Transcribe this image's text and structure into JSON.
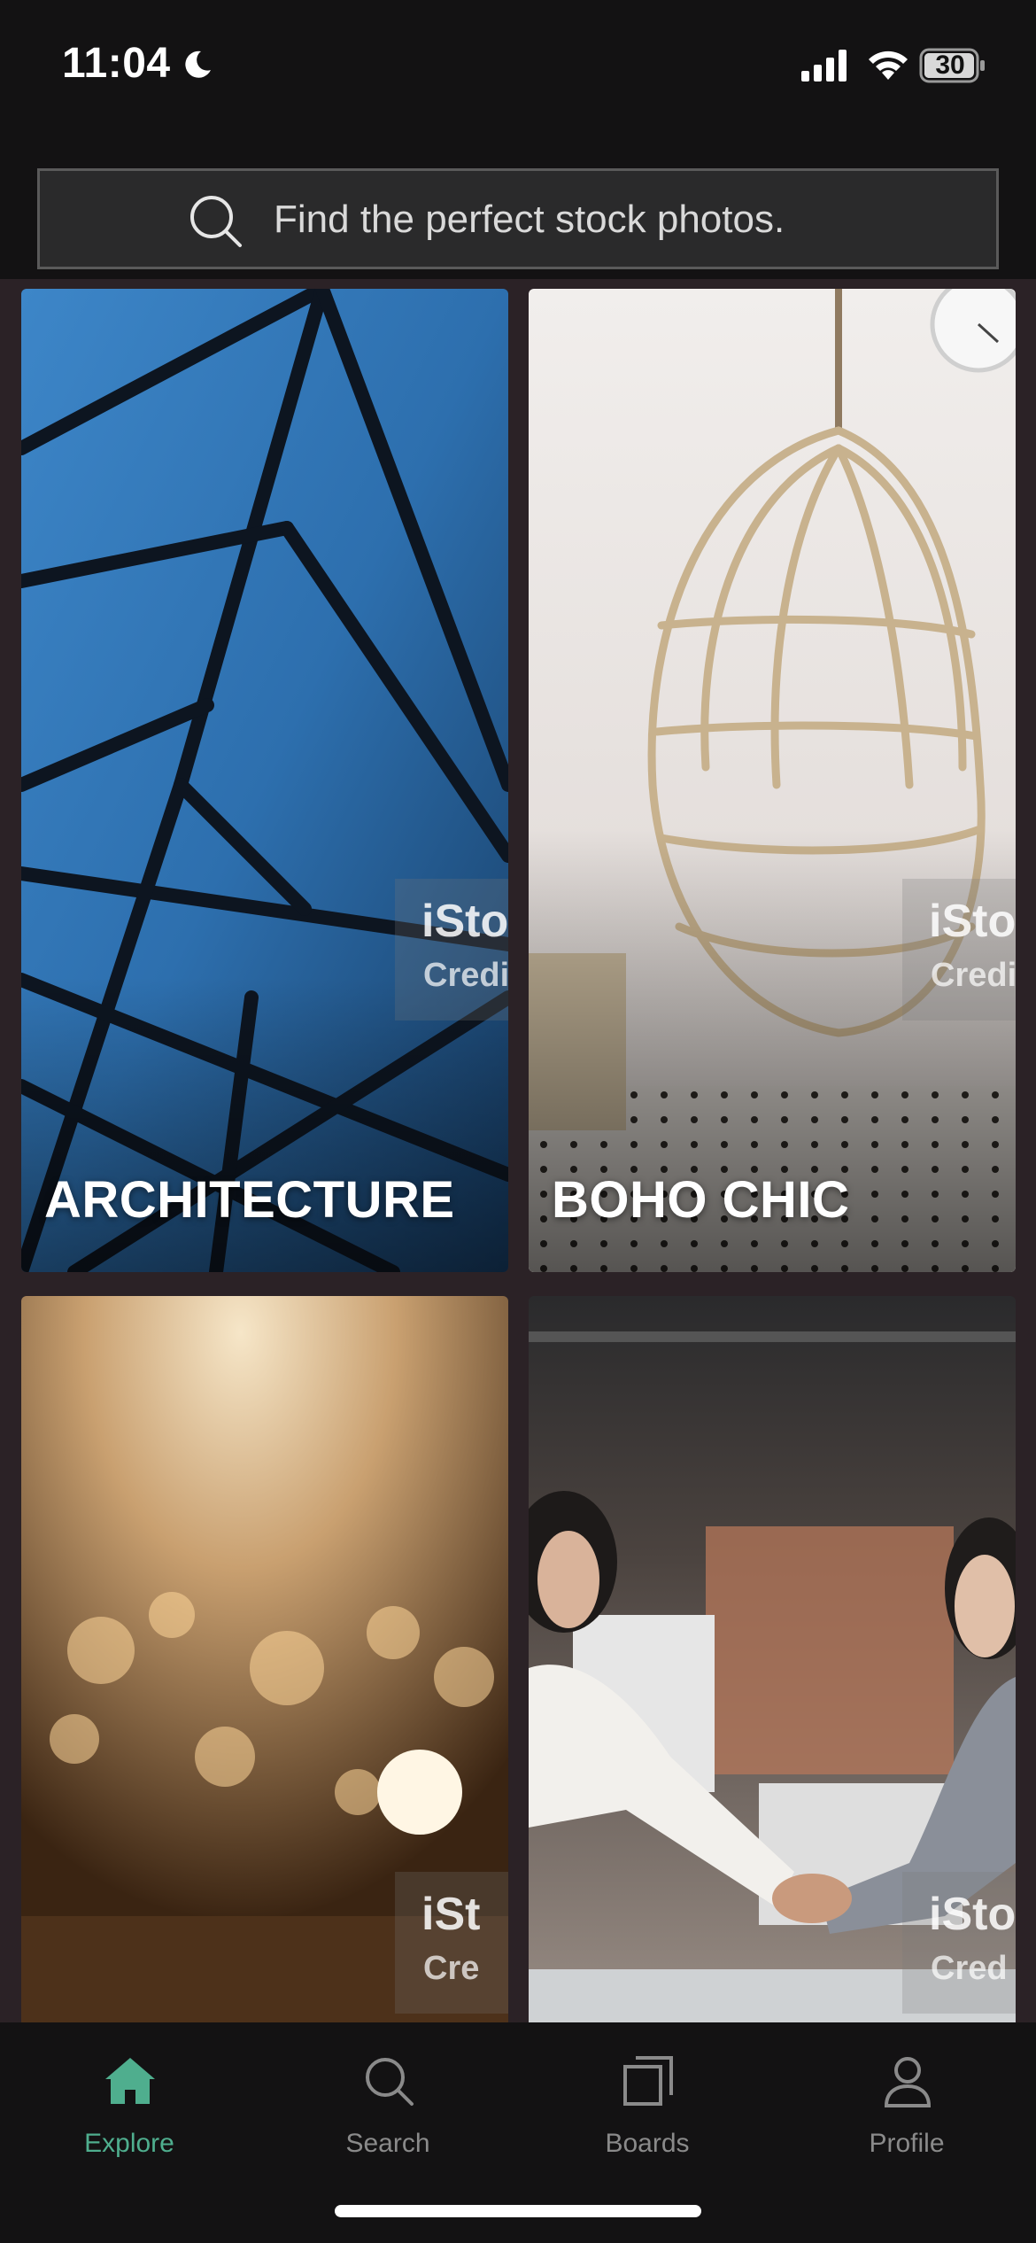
{
  "status_bar": {
    "time": "11:04",
    "battery": "30"
  },
  "search": {
    "placeholder": "Find the perfect stock photos."
  },
  "tiles": [
    {
      "label": "ARCHITECTURE",
      "watermark_line1": "iSto",
      "watermark_line2": "Credi"
    },
    {
      "label": "BOHO CHIC",
      "watermark_line1": "iSto",
      "watermark_line2": "Credi"
    },
    {
      "label": "",
      "watermark_line1": "iSt",
      "watermark_line2": "Cre"
    },
    {
      "label": "",
      "watermark_line1": "iSto",
      "watermark_line2": "Cred"
    }
  ],
  "tab_bar": {
    "tabs": [
      {
        "label": "Explore",
        "icon": "home-icon",
        "active": true
      },
      {
        "label": "Search",
        "icon": "search-icon",
        "active": false
      },
      {
        "label": "Boards",
        "icon": "boards-icon",
        "active": false
      },
      {
        "label": "Profile",
        "icon": "profile-icon",
        "active": false
      }
    ]
  },
  "colors": {
    "accent": "#4fae8e",
    "background": "#131213",
    "grid_background": "#2b2226"
  }
}
